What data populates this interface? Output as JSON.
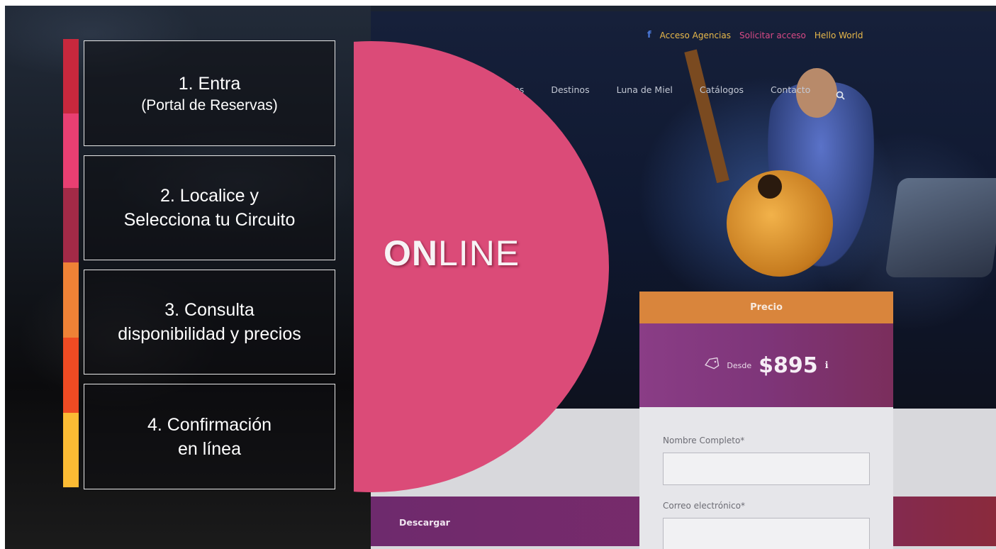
{
  "website": {
    "topbar": {
      "facebook_icon": "f",
      "acceso_agencias": "Acceso Agencias",
      "solicitar_acceso": "Solicitar acceso",
      "hello_world": "Hello World"
    },
    "nav": {
      "items": [
        "adores",
        "Destinos",
        "Luna de Miel",
        "Catálogos",
        "Contacto"
      ],
      "search_icon": "search-icon"
    },
    "price_card": {
      "header": "Precio",
      "tag_icon": "tag-icon",
      "desde": "Desde",
      "amount": "$895",
      "info_icon": "info-icon",
      "fields": [
        {
          "label": "Nombre Completo*"
        },
        {
          "label": "Correo electrónico*"
        }
      ]
    },
    "download_label": "Descargar"
  },
  "online": {
    "bold": "ON",
    "regular": "LINE"
  },
  "steps": [
    {
      "line1": "1. Entra",
      "line2": "(Portal de Reservas)"
    },
    {
      "line1": "2. Localice y",
      "line2": "Selecciona tu Circuito"
    },
    {
      "line1": "3. Consulta",
      "line2": "disponibilidad y precios"
    },
    {
      "line1": "4. Confirmación",
      "line2": "en línea"
    }
  ],
  "colors": {
    "circle": "#db4b78",
    "stripe": [
      "#c8283d",
      "#e93f72",
      "#a32a47",
      "#ef8236",
      "#ef4b23",
      "#fbbb34"
    ]
  }
}
